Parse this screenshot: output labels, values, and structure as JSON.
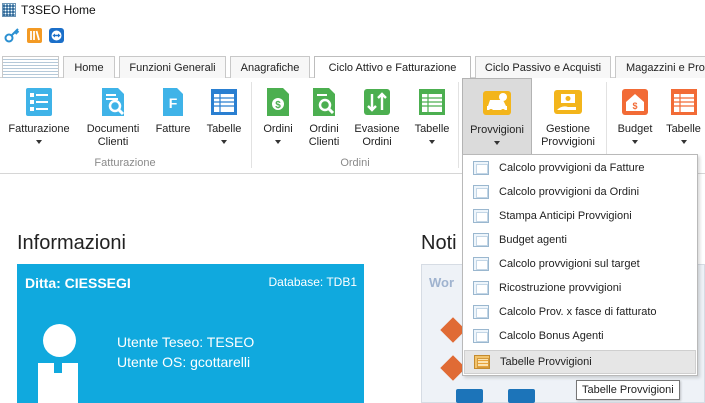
{
  "window": {
    "title": "T3SEO Home"
  },
  "tabs": [
    {
      "label": ""
    },
    {
      "label": "Home"
    },
    {
      "label": "Funzioni Generali"
    },
    {
      "label": "Anagrafiche"
    },
    {
      "label": "Ciclo Attivo e Fatturazione"
    },
    {
      "label": "Ciclo Passivo e Acquisti"
    },
    {
      "label": "Magazzini e Pro"
    }
  ],
  "ribbon": {
    "buttons": [
      {
        "label": "Fatturazione",
        "icon": "invoice-checklist-icon"
      },
      {
        "label": "Documenti\nClienti",
        "icon": "document-search-icon"
      },
      {
        "label": "Fatture",
        "icon": "invoice-icon"
      },
      {
        "label": "Tabelle",
        "icon": "table-icon"
      },
      {
        "label": "Ordini",
        "icon": "order-money-icon"
      },
      {
        "label": "Ordini\nClienti",
        "icon": "order-search-icon"
      },
      {
        "label": "Evasione\nOrdini",
        "icon": "order-fulfillment-icon"
      },
      {
        "label": "Tabelle",
        "icon": "table-icon"
      },
      {
        "label": "Provvigioni",
        "icon": "commission-car-icon"
      },
      {
        "label": "Gestione\nProvvigioni",
        "icon": "commission-hand-icon"
      },
      {
        "label": "Budget",
        "icon": "budget-house-icon"
      },
      {
        "label": "Tabelle",
        "icon": "table-icon"
      }
    ],
    "groups": [
      {
        "label": "Fatturazione"
      },
      {
        "label": "Ordini"
      }
    ]
  },
  "main": {
    "info_title": "Informazioni",
    "news_title": "Noti",
    "card": {
      "company": "Ditta: CIESSEGI",
      "database": "Database: TDB1",
      "user_teseo": "Utente Teseo: TESEO",
      "user_os": "Utente OS: gcottarelli"
    },
    "workflow_title": "Wor"
  },
  "dropdown": {
    "items": [
      {
        "label": "Calcolo provvigioni da Fatture"
      },
      {
        "label": "Calcolo provvigioni da Ordini"
      },
      {
        "label": "Stampa Anticipi Provvigioni"
      },
      {
        "label": "Budget agenti"
      },
      {
        "label": "Calcolo provvigioni sul target"
      },
      {
        "label": "Ricostruzione provvigioni"
      },
      {
        "label": "Calcolo Prov. x fasce di fatturato"
      },
      {
        "label": "Calcolo Bonus Agenti"
      },
      {
        "label": "Tabelle Provvigioni"
      }
    ],
    "tooltip": "Tabelle Provvigioni"
  },
  "colors": {
    "card_bg": "#10a9de",
    "accent_blue": "#1c74b9",
    "accent_orange": "#e06b35",
    "icon_green": "#4caf50",
    "icon_yellow": "#f3b51b",
    "icon_cyan": "#3fb3e8"
  }
}
